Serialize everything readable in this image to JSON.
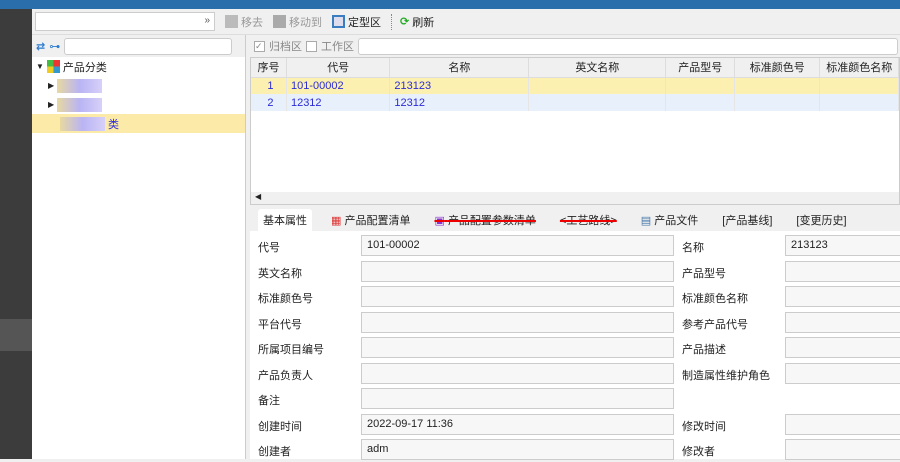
{
  "toolbar": {
    "remove": "移去",
    "move_to": "移动到",
    "finalize": "定型区",
    "refresh": "刷新"
  },
  "filter": {
    "archive": "归档区",
    "work": "工作区"
  },
  "tree": {
    "root": "产品分类",
    "child3_suffix": "类"
  },
  "grid": {
    "headers": [
      "序号",
      "代号",
      "名称",
      "英文名称",
      "产品型号",
      "标准颜色号",
      "标准颜色名称"
    ],
    "rows": [
      [
        "1",
        "101-00002",
        "213123",
        "",
        "",
        "",
        ""
      ],
      [
        "2",
        "12312",
        "12312",
        "",
        "",
        "",
        ""
      ]
    ]
  },
  "tabs": [
    "基本属性",
    "产品配置清单",
    "产品配置参数清单",
    "<工艺路线>",
    "产品文件",
    "[产品基线]",
    "[变更历史]"
  ],
  "form": {
    "rows": [
      {
        "l": "代号",
        "v": "101-00002",
        "l2": "名称",
        "v2": "213123"
      },
      {
        "l": "英文名称",
        "v": "",
        "l2": "产品型号",
        "v2": ""
      },
      {
        "l": "标准颜色号",
        "v": "",
        "l2": "标准颜色名称",
        "v2": ""
      },
      {
        "l": "平台代号",
        "v": "",
        "l2": "参考产品代号",
        "v2": ""
      },
      {
        "l": "所属项目编号",
        "v": "",
        "l2": "产品描述",
        "v2": ""
      },
      {
        "l": "产品负责人",
        "v": "",
        "l2": "制造属性维护角色",
        "v2": ""
      },
      {
        "l": "备注",
        "v": "",
        "l2": "",
        "v2": ""
      },
      {
        "l": "创建时间",
        "v": "2022-09-17 11:36",
        "l2": "修改时间",
        "v2": ""
      },
      {
        "l": "创建者",
        "v": "adm",
        "l2": "修改者",
        "v2": ""
      }
    ]
  }
}
